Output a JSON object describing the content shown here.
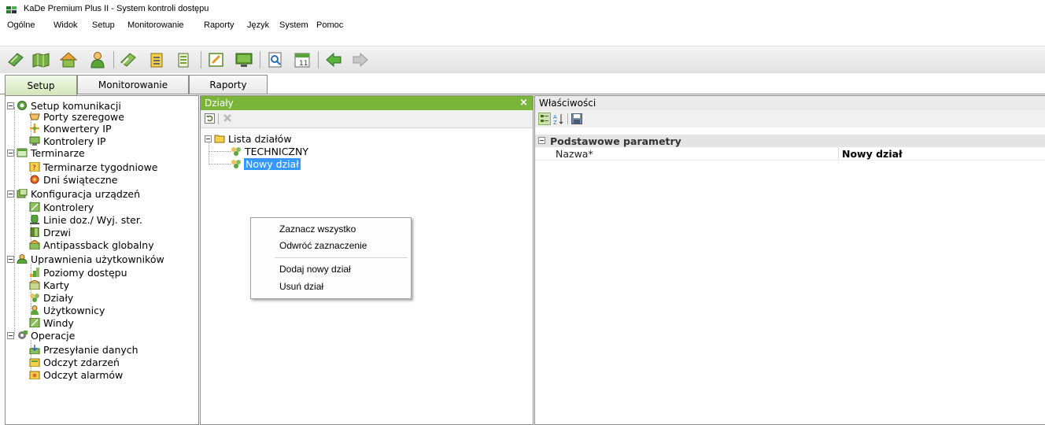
{
  "window": {
    "title": "KaDe Premium Plus II - System kontroli dostępu"
  },
  "menubar": [
    "Ogólne",
    "Widok",
    "Setup",
    "Monitorowanie",
    "Raporty",
    "Język",
    "System",
    "Pomoc"
  ],
  "toolbar": {
    "icons": [
      "hardware-icon",
      "map-icon",
      "home-icon",
      "user-icon",
      "controller-icon",
      "notepad-icon",
      "schedule-icon",
      "edit-icon",
      "monitor-icon",
      "search-document-icon",
      "calendar-icon",
      "back-arrow-icon",
      "forward-arrow-icon"
    ]
  },
  "tabs": {
    "setup": "Setup",
    "monitorowanie": "Monitorowanie",
    "raporty": "Raporty"
  },
  "nav_tree": {
    "comm": {
      "label": "Setup komunikacji",
      "items": [
        "Porty szeregowe",
        "Konwertery IP",
        "Kontrolery IP"
      ]
    },
    "terminarze": {
      "label": "Terminarze",
      "items": [
        "Terminarze tygodniowe",
        "Dni świąteczne"
      ]
    },
    "konfig": {
      "label": "Konfiguracja urządzeń",
      "items": [
        "Kontrolery",
        "Linie doz./ Wyj. ster.",
        "Drzwi",
        "Antipassback globalny"
      ]
    },
    "uprawnienia": {
      "label": "Uprawnienia użytkowników",
      "items": [
        "Poziomy dostępu",
        "Karty",
        "Działy",
        "Użytkownicy",
        "Windy"
      ]
    },
    "operacje": {
      "label": "Operacje",
      "items": [
        "Przesyłanie danych",
        "Odczyt zdarzeń",
        "Odczyt alarmów"
      ]
    }
  },
  "dzialy": {
    "header": "Działy",
    "close": "×",
    "root": "Lista działów",
    "items": [
      "TECHNICZNY",
      "Nowy dział"
    ]
  },
  "wlasciwosci": {
    "header": "Właściwości",
    "category": "Podstawowe parametry",
    "prop_name": "Nazwa*",
    "prop_value": "Nowy dział"
  },
  "context_menu": {
    "items": [
      "Zaznacz wszystko",
      "Odwróć zaznaczenie",
      "Dodaj nowy dział",
      "Usuń dział"
    ]
  },
  "colors": {
    "accent_green": "#7ab53a",
    "selection": "#3399ff"
  }
}
